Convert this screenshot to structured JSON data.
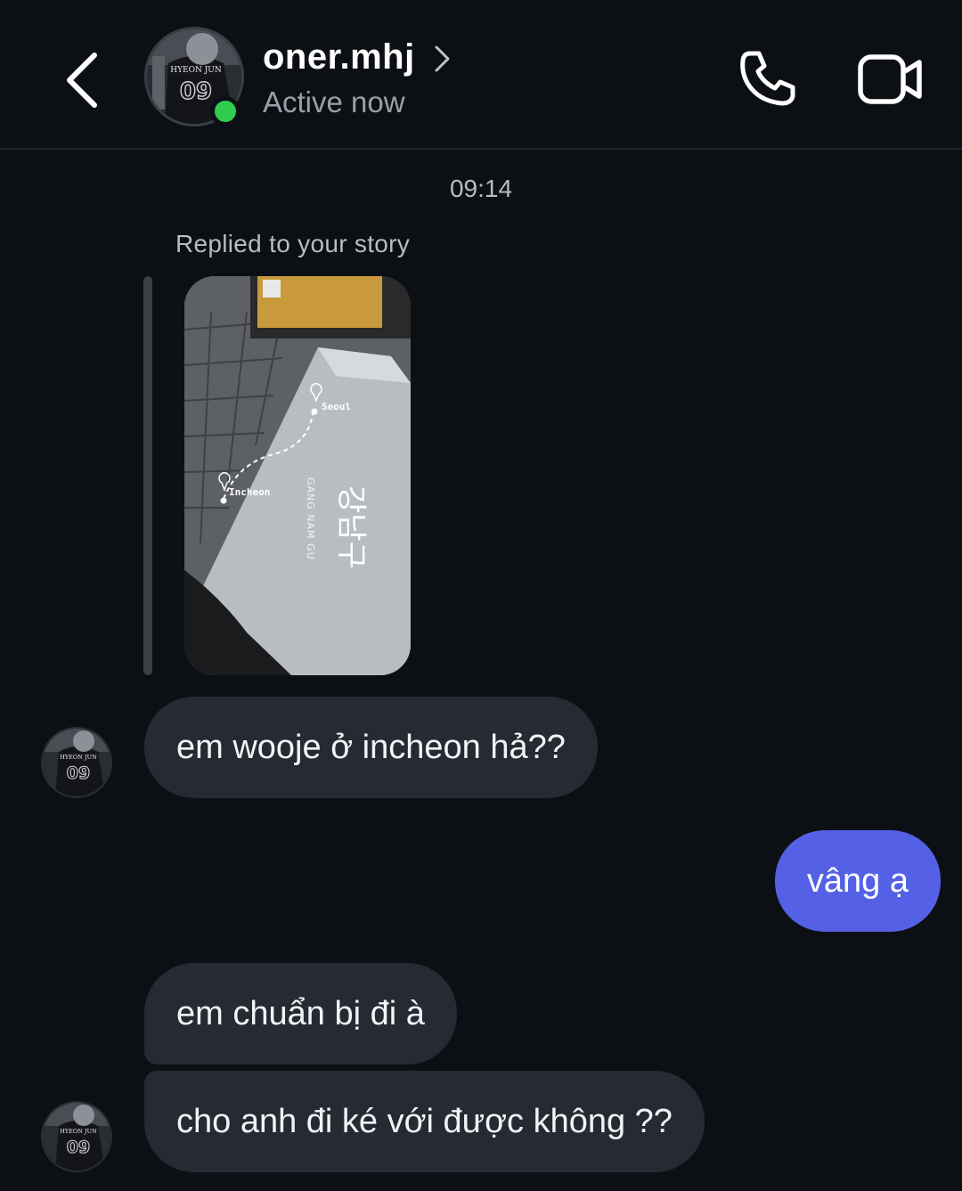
{
  "header": {
    "username": "oner.mhj",
    "status": "Active now",
    "avatar_jersey_name": "HYEON JUN",
    "avatar_jersey_number": "09"
  },
  "thread": {
    "timestamp": "09:14",
    "reply_label": "Replied to your story",
    "story": {
      "map_from": "Incheon",
      "map_to": "Seoul",
      "bench_hangul": "강남구",
      "bench_text": "GANG NAM GU"
    },
    "messages": [
      {
        "sender": "them",
        "text": "em wooje ở incheon hả??"
      },
      {
        "sender": "me",
        "text": "vâng ạ"
      },
      {
        "sender": "them",
        "text": "em chuẩn bị đi à"
      },
      {
        "sender": "them",
        "text": "cho anh đi ké với được không ??"
      }
    ]
  },
  "colors": {
    "background": "#0c0f14",
    "incoming_bubble": "#262a33",
    "outgoing_bubble": "#5461e6",
    "online": "#2ecc4f"
  }
}
